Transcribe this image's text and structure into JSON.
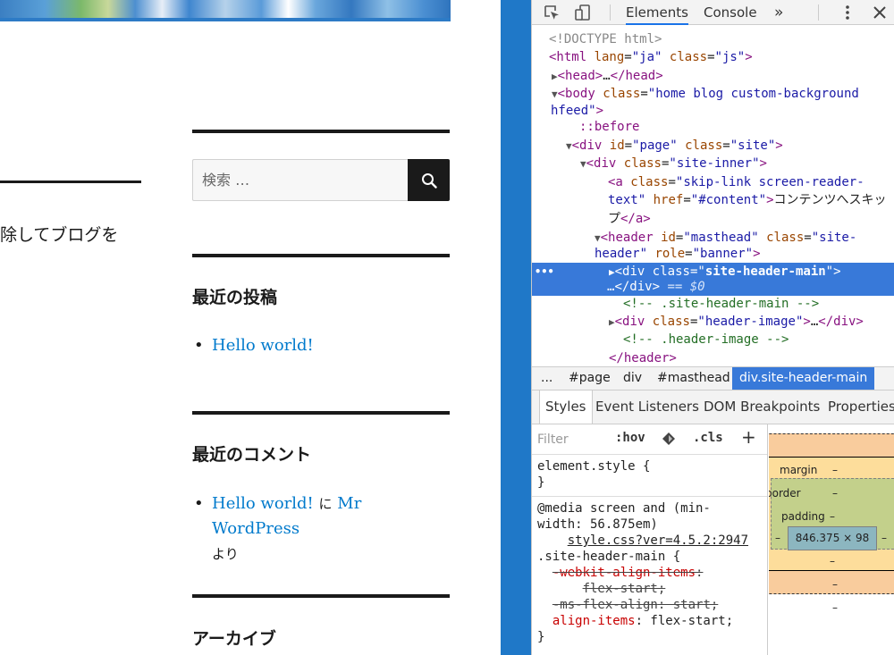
{
  "site": {
    "left_text": "除してブログを",
    "search": {
      "placeholder": "検索 …"
    },
    "recent_posts": {
      "title": "最近の投稿",
      "items": [
        "Hello world!"
      ]
    },
    "recent_comments": {
      "title": "最近のコメント",
      "items": [
        {
          "post": "Hello world!",
          "on": "に",
          "author": "Mr WordPress",
          "suffix": "より"
        }
      ]
    },
    "archives": {
      "title": "アーカイブ"
    }
  },
  "devtools": {
    "tabs": [
      "Elements",
      "Console"
    ],
    "more_tabs": "»",
    "active_tab": "Elements",
    "dom": {
      "doctype": "<!DOCTYPE html>",
      "html_lang": "ja",
      "html_class": "js",
      "head_collapsed": "…",
      "body_class_1": "home blog custom-background",
      "body_class_2": "hfeed",
      "before": "::before",
      "page_id": "page",
      "page_class": "site",
      "inner_class": "site-inner",
      "skip_class_1": "skip-link screen-reader-",
      "skip_class_2": "text",
      "skip_href": "#content",
      "skip_text_1": "コンテンツへスキッ",
      "skip_text_2": "プ",
      "header_id": "masthead",
      "header_class_1": "site-",
      "header_class_2": "header",
      "header_role": "banner",
      "selected_class": "site-header-main",
      "selected_ellipsis": "…",
      "selected_ref": "== $0",
      "comment_1": "<!-- .site-header-main -->",
      "header_image_class": "header-image",
      "comment_2": "<!-- .header-image -->",
      "header_close": "</header>",
      "ellipsis_dots": "•••"
    },
    "breadcrumb": [
      "...",
      "#page",
      "div",
      "#masthead",
      "div.site-header-main"
    ],
    "sub_tabs": [
      "Styles",
      "Event Listeners",
      "DOM Breakpoints",
      "Properties"
    ],
    "styles": {
      "filter_placeholder": "Filter",
      "hov": ":hov",
      "cls": ".cls",
      "plus": "+",
      "element_style": "element.style {",
      "close_brace": "}",
      "media_1": "@media screen and (min-",
      "media_2": "width: 56.875em)",
      "source": "style.css?ver=4.5.2:2947",
      "selector": ".site-header-main {",
      "decl_1_prop": "-webkit-align-items",
      "decl_1_val_1": ":",
      "decl_1_val_2": "flex-start;",
      "decl_2_prop": "-ms-flex-align",
      "decl_2_val": ": start;",
      "decl_3_prop": "align-items",
      "decl_3_val": ": flex-start;"
    },
    "box_model": {
      "margin_label": "margin",
      "margin_value": "–",
      "border_label": "border",
      "border_value": "–",
      "padding_label": "padding",
      "padding_value": "–",
      "content": "846.375 × 98",
      "padding_left": "–",
      "padding_right": "–",
      "padding_bottom": "–",
      "border_bottom": "–",
      "margin_bottom": "–"
    }
  },
  "colors": {
    "background_blue": "#1f78c8",
    "link": "#007acc",
    "selection": "#3879d9"
  }
}
